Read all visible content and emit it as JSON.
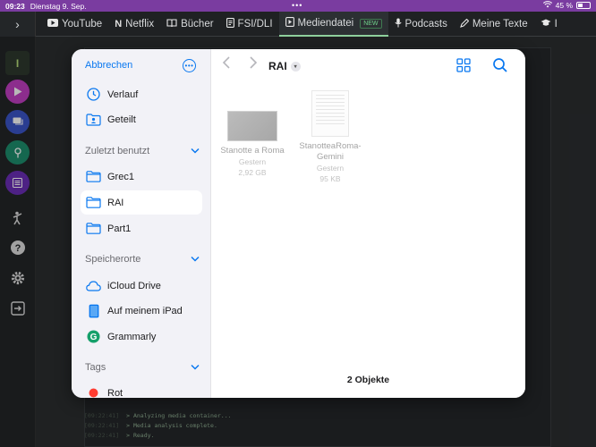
{
  "status": {
    "time": "09:23",
    "date": "Dienstag 9. Sep.",
    "battery": "45 %",
    "battery_level": 0.45,
    "dots": "•••"
  },
  "tabs": [
    {
      "label": "YouTube",
      "icon": "youtube-icon"
    },
    {
      "label": "Netflix",
      "icon": "netflix-icon"
    },
    {
      "label": "Bücher",
      "icon": "book-icon"
    },
    {
      "label": "FSI/DLI",
      "icon": "document-icon"
    },
    {
      "label": "Mediendatei",
      "icon": "media-file-icon",
      "badge": "NEW",
      "active": true
    },
    {
      "label": "Podcasts",
      "icon": "microphone-icon"
    },
    {
      "label": "Meine Texte",
      "icon": "pen-icon"
    },
    {
      "label": "I",
      "icon": "graduation-cap-icon"
    }
  ],
  "rail": {
    "top_letter": "I"
  },
  "log": [
    {
      "ts": "[09:22:41]",
      "msg": "> Analyzing media container..."
    },
    {
      "ts": "[09:22:41]",
      "msg": "> Media analysis complete."
    },
    {
      "ts": "[09:22:41]",
      "msg": "> Ready."
    }
  ],
  "picker": {
    "cancel": "Abbrechen",
    "more": "•••",
    "quick": [
      {
        "label": "Verlauf",
        "icon": "clock-icon"
      },
      {
        "label": "Geteilt",
        "icon": "shared-folder-icon"
      }
    ],
    "recent_header": "Zuletzt benutzt",
    "recent": [
      {
        "label": "Grec1",
        "icon": "folder-icon"
      },
      {
        "label": "RAI",
        "icon": "folder-icon",
        "selected": true
      },
      {
        "label": "Part1",
        "icon": "folder-icon"
      }
    ],
    "locations_header": "Speicherorte",
    "locations": [
      {
        "label": "iCloud Drive",
        "icon": "cloud-icon"
      },
      {
        "label": "Auf meinem iPad",
        "icon": "ipad-icon"
      },
      {
        "label": "Grammarly",
        "icon": "grammarly-icon"
      }
    ],
    "tags_header": "Tags",
    "tags": [
      {
        "label": "Rot",
        "color": "#ff3b30"
      }
    ],
    "current_folder": "RAI",
    "files": [
      {
        "name": "Stanotte a Roma",
        "date": "Gestern",
        "size": "2,92 GB"
      },
      {
        "name_line1": "StanotteaRoma-",
        "name_line2": "Gemini",
        "date": "Gestern",
        "size": "95 KB"
      }
    ],
    "count": "2 Objekte"
  },
  "colors": {
    "accent": "#0a78f0",
    "status_bar": "#7a3ca0",
    "tab_active_underline": "#8fd19e"
  }
}
